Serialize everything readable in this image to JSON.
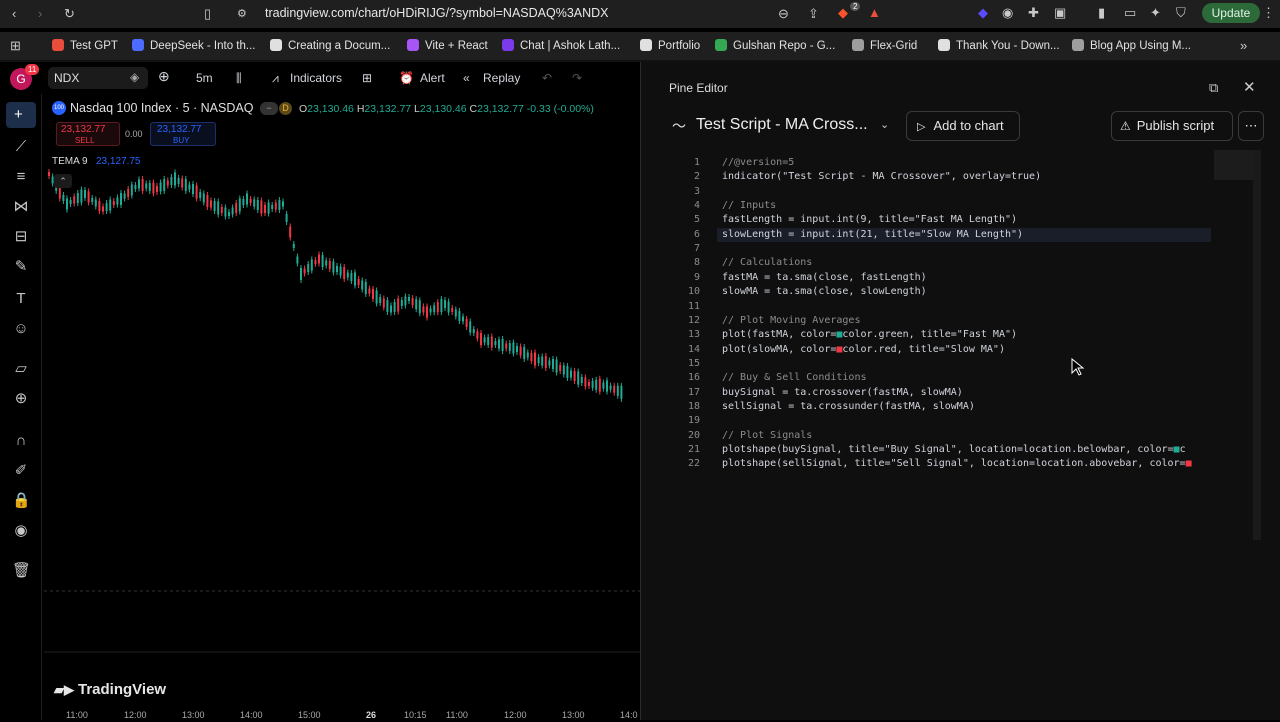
{
  "browser": {
    "url": "tradingview.com/chart/oHDiRIJG/?symbol=NASDAQ%3ANDX",
    "update_label": "Update",
    "badge": "2"
  },
  "bookmarks": [
    {
      "label": "Test GPT",
      "color": "#e94e3c"
    },
    {
      "label": "DeepSeek - Into th...",
      "color": "#4d6bfe"
    },
    {
      "label": "Creating a Docum...",
      "color": "#e0e0e0"
    },
    {
      "label": "Vite + React",
      "color": "#a855f7"
    },
    {
      "label": "Chat | Ashok Lath...",
      "color": "#7c3aed"
    },
    {
      "label": "Portfolio",
      "color": "#e0e0e0"
    },
    {
      "label": "Gulshan Repo - G...",
      "color": "#34a853"
    },
    {
      "label": "Flex-Grid",
      "color": "#9e9e9e"
    },
    {
      "label": "Thank You - Down...",
      "color": "#e0e0e0"
    },
    {
      "label": "Blog App Using M...",
      "color": "#9e9e9e"
    }
  ],
  "toolbar": {
    "avatar": "G",
    "avatar_badge": "11",
    "symbol": "NDX",
    "interval": "5m",
    "indicators": "Indicators",
    "alert": "Alert",
    "replay": "Replay"
  },
  "chart": {
    "title": "Nasdaq 100 Index · 5 · NASDAQ",
    "badge100": "100",
    "d_badge": "D",
    "ohlc": {
      "o_label": "O",
      "o": "23,130.46",
      "h_label": "H",
      "h": "23,132.77",
      "l_label": "L",
      "l": "23,130.46",
      "c_label": "C",
      "c": "23,132.77",
      "change": "-0.33 (-0.00%)"
    },
    "sell_price": "23,132.77",
    "sell_label": "SELL",
    "spread": "0.00",
    "buy_price": "23,132.77",
    "buy_label": "BUY",
    "tema_label": "TEMA 9",
    "tema_value": "23,127.75",
    "logo": "TradingView",
    "time_labels": [
      "11:00",
      "12:00",
      "13:00",
      "14:00",
      "15:00",
      "26",
      "10:15",
      "11:00",
      "12:00",
      "13:00",
      "14:0"
    ]
  },
  "editor": {
    "panel_title": "Pine Editor",
    "script_name": "Test Script - MA Cross...",
    "add_to_chart": "Add to chart",
    "publish": "Publish script",
    "code_lines": [
      "//@version=5",
      "indicator(\"Test Script - MA Crossover\", overlay=true)",
      "",
      "// Inputs",
      "fastLength = input.int(9, title=\"Fast MA Length\")",
      "slowLength = input.int(21, title=\"Slow MA Length\")",
      "",
      "// Calculations",
      "fastMA = ta.sma(close, fastLength)",
      "slowMA = ta.sma(close, slowLength)",
      "",
      "// Plot Moving Averages",
      "plot(fastMA, color=■color.green, title=\"Fast MA\")",
      "plot(slowMA, color=■color.red, title=\"Slow MA\")",
      "",
      "// Buy & Sell Conditions",
      "buySignal = ta.crossover(fastMA, slowMA)",
      "sellSignal = ta.crossunder(fastMA, slowMA)",
      "",
      "// Plot Signals",
      "plotshape(buySignal, title=\"Buy Signal\", location=location.belowbar, color=■c",
      "plotshape(sellSignal, title=\"Sell Signal\", location=location.abovebar, color=■"
    ],
    "line_numbers": [
      "1",
      "2",
      "3",
      "4",
      "5",
      "6",
      "7",
      "8",
      "9",
      "10",
      "11",
      "12",
      "13",
      "14",
      "15",
      "16",
      "17",
      "18",
      "19",
      "20",
      "21",
      "22"
    ]
  },
  "colors": {
    "sell": "#f23645",
    "buy": "#2962ff",
    "up": "#22ab94",
    "down": "#f23645",
    "tema": "#2962ff"
  }
}
